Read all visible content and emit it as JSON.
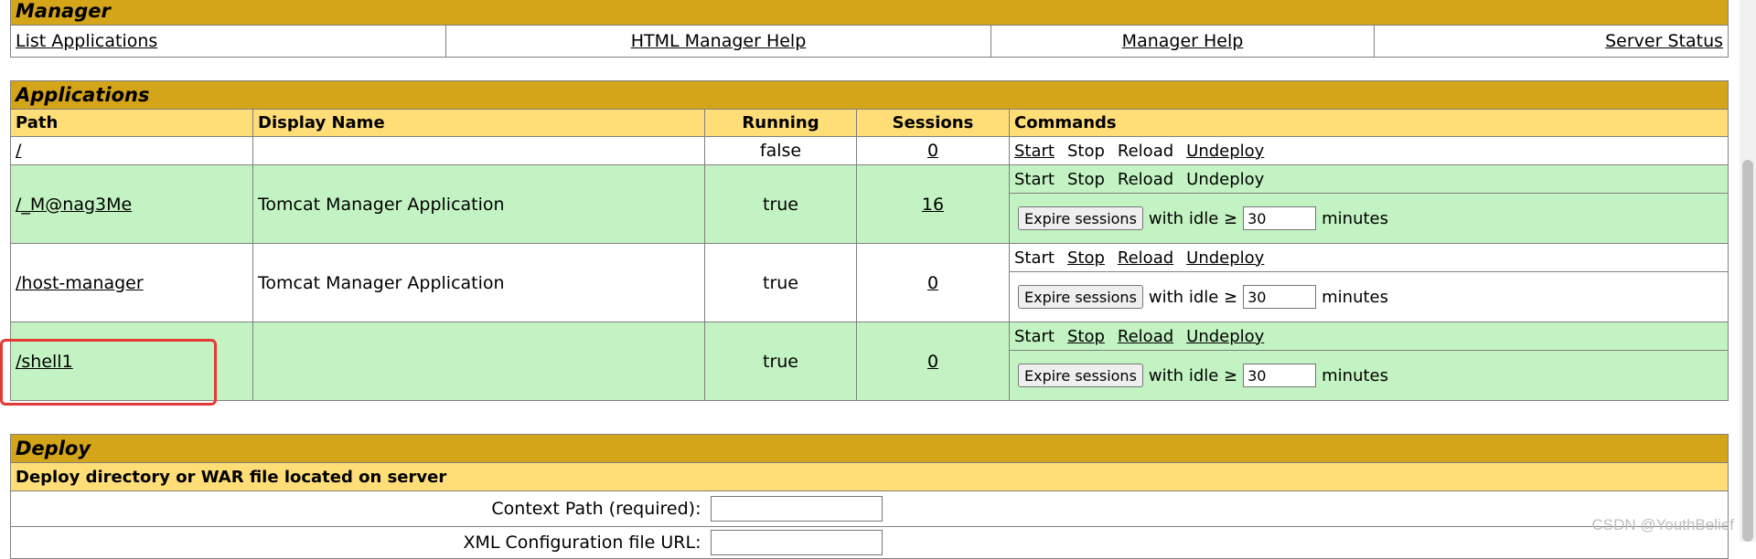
{
  "manager": {
    "title": "Manager",
    "links": [
      "List Applications",
      "HTML Manager Help",
      "Manager Help",
      "Server Status"
    ]
  },
  "applications": {
    "title": "Applications",
    "headers": [
      "Path",
      "Display Name",
      "Running",
      "Sessions",
      "Commands"
    ],
    "rows": [
      {
        "path": "/",
        "display_name": "",
        "running": "false",
        "sessions": "0",
        "commands": [
          "Start",
          "Stop",
          "Reload",
          "Undeploy"
        ],
        "expire": false
      },
      {
        "path": "/_M@nag3Me",
        "display_name": "Tomcat Manager Application",
        "running": "true",
        "sessions": "16",
        "commands": [
          "Start",
          "Stop",
          "Reload",
          "Undeploy"
        ],
        "expire": true
      },
      {
        "path": "/host-manager",
        "display_name": "Tomcat Manager Application",
        "running": "true",
        "sessions": "0",
        "commands": [
          "Start",
          "Stop",
          "Reload",
          "Undeploy"
        ],
        "expire": true
      },
      {
        "path": "/shell1",
        "display_name": "",
        "running": "true",
        "sessions": "0",
        "commands": [
          "Start",
          "Stop",
          "Reload",
          "Undeploy"
        ],
        "expire": true
      }
    ],
    "expire": {
      "button": "Expire sessions",
      "with_idle": "with idle ≥",
      "idle_value": "30",
      "minutes": "minutes"
    }
  },
  "deploy": {
    "title": "Deploy",
    "subtitle": "Deploy directory or WAR file located on server",
    "context_path_label": "Context Path (required):",
    "xml_config_label": "XML Configuration file URL:"
  },
  "watermark": "CSDN @YouthBelief",
  "colors": {
    "section_title_bg": "#d4a419",
    "column_header_bg": "#ffdd77",
    "row_green_bg": "#c3f3c3",
    "highlight_border": "#e53935"
  }
}
